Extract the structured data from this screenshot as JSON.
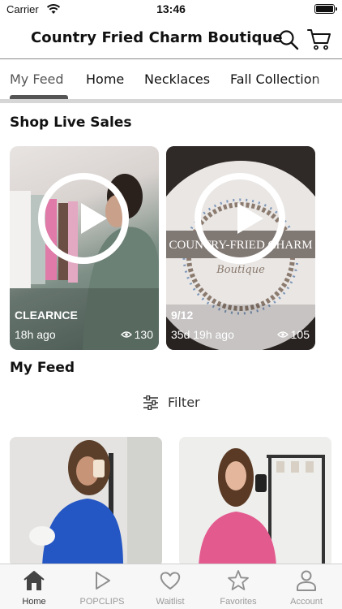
{
  "status_bar": {
    "carrier": "Carrier",
    "time": "13:46"
  },
  "header": {
    "title": "Country Fried Charm Boutique"
  },
  "category_tabs": [
    {
      "label": "My Feed",
      "active": true
    },
    {
      "label": "Home"
    },
    {
      "label": "Necklaces"
    },
    {
      "label": "Fall Collection"
    }
  ],
  "live_sales": {
    "title": "Shop Live Sales",
    "cards": [
      {
        "label": "CLEARNCE",
        "age": "18h ago",
        "views": "130"
      },
      {
        "label": "9/12",
        "age": "35d 19h ago",
        "views": "105"
      }
    ],
    "logo_text": "COUNTRY-FRIED CHARM Boutique"
  },
  "feed": {
    "title": "My Feed",
    "filter_label": "Filter"
  },
  "bottom_tabs": [
    {
      "label": "Home",
      "icon": "home-icon",
      "active": true
    },
    {
      "label": "POPCLIPS",
      "icon": "play-icon"
    },
    {
      "label": "Waitlist",
      "icon": "heart-icon"
    },
    {
      "label": "Favorites",
      "icon": "star-icon"
    },
    {
      "label": "Account",
      "icon": "person-icon"
    }
  ],
  "colors": {
    "accent": "#555555",
    "tab_inactive": "#9a9a9a"
  }
}
